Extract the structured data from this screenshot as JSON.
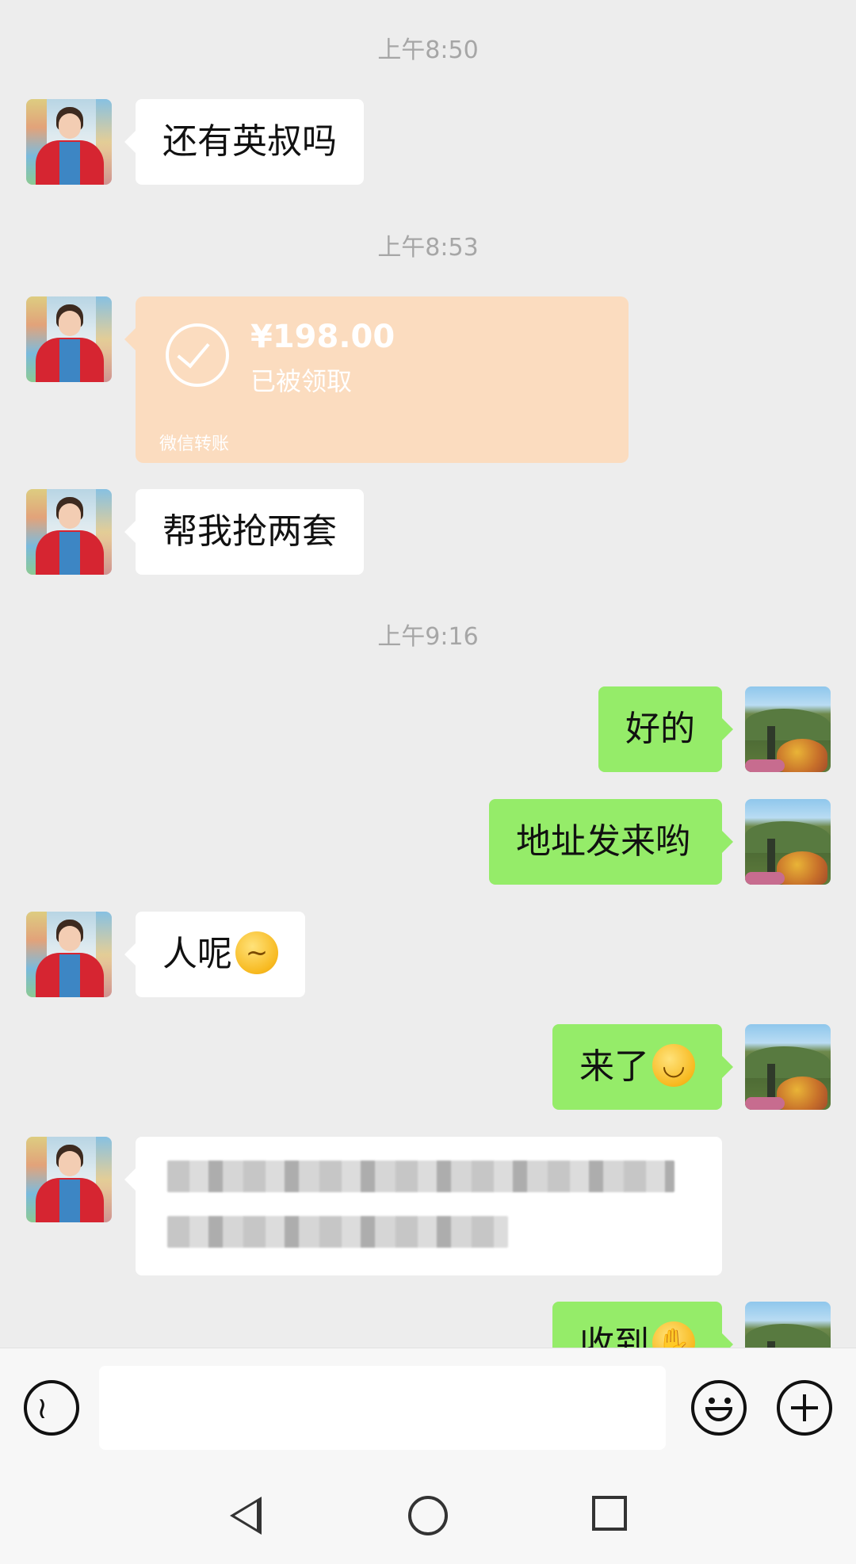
{
  "timestamps": [
    "上午8:50",
    "上午8:53",
    "上午9:16"
  ],
  "messages": {
    "m1": "还有英叔吗",
    "transfer": {
      "amount": "¥198.00",
      "status": "已被领取",
      "footer": "微信转账"
    },
    "m2": "帮我抢两套",
    "m3": "好的",
    "m4": "地址发来哟",
    "m5": "人呢",
    "m5_emoji": "thinking-face-emoji",
    "m6": "来了",
    "m6_emoji": "grinning-face-emoji",
    "m8": "收到",
    "m8_emoji": "ok-hand-emoji"
  },
  "colors": {
    "chat_bg": "#ededed",
    "incoming_bubble": "#ffffff",
    "outgoing_bubble": "#95ec69",
    "transfer_card": "#fbdcbf",
    "timestamp_text": "#a6a6a6"
  },
  "input_bar": {
    "voice_icon": "voice-icon",
    "emoji_icon": "emoji-icon",
    "plus_icon": "plus-icon"
  },
  "nav_bar": {
    "back_icon": "nav-back-icon",
    "home_icon": "nav-home-icon",
    "recents_icon": "nav-recents-icon"
  }
}
